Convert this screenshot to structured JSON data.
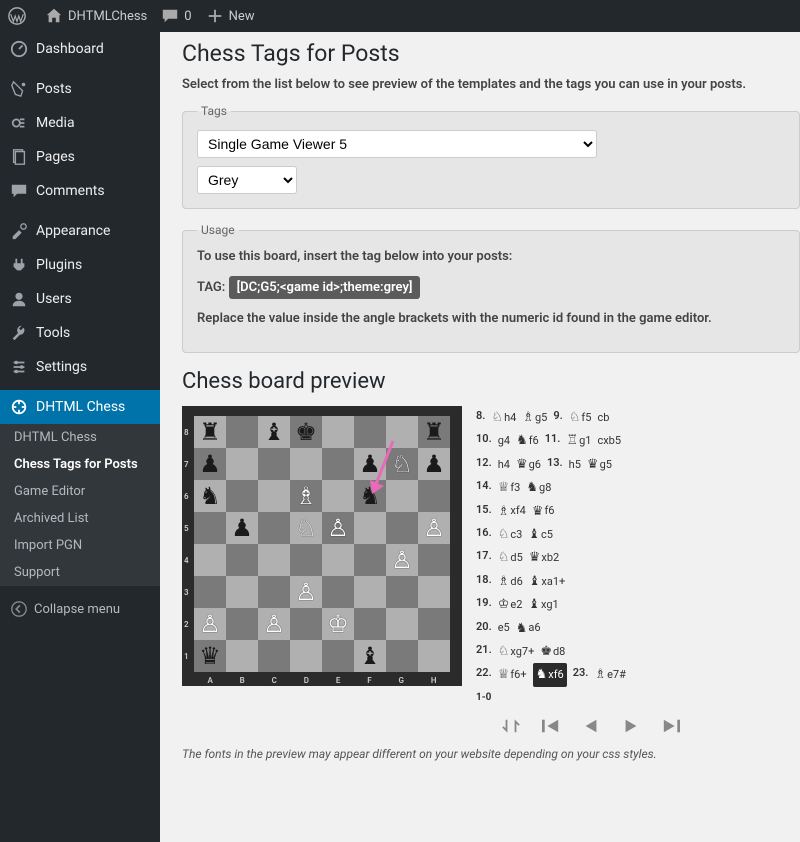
{
  "topbar": {
    "site": "DHTMLChess",
    "comments": "0",
    "new": "New"
  },
  "sidebar": {
    "dashboard": "Dashboard",
    "posts": "Posts",
    "media": "Media",
    "pages": "Pages",
    "comments": "Comments",
    "appearance": "Appearance",
    "plugins": "Plugins",
    "users": "Users",
    "tools": "Tools",
    "settings": "Settings",
    "dhtml_chess": "DHTML Chess",
    "sub": {
      "dhtml_chess": "DHTML Chess",
      "chess_tags": "Chess Tags for Posts",
      "game_editor": "Game Editor",
      "archived_list": "Archived List",
      "import_pgn": "Import PGN",
      "support": "Support"
    },
    "collapse": "Collapse menu"
  },
  "page": {
    "title": "Chess Tags for Posts",
    "intro": "Select from the list below to see preview of the templates and the tags you can use in your posts.",
    "tags_legend": "Tags",
    "template_selected": "Single Game Viewer 5",
    "theme_selected": "Grey",
    "usage_legend": "Usage",
    "usage_line1": "To use this board, insert the tag below into your posts:",
    "tag_label": "TAG:",
    "tag_value": "[DC;G5;<game id>;theme:grey]",
    "usage_line2": "Replace the value inside the angle brackets with the numeric id found in the game editor.",
    "preview_title": "Chess board preview",
    "footnote": "The fonts in the preview may appear different on your website depending on your css styles."
  },
  "board": {
    "ranks": [
      "8",
      "7",
      "6",
      "5",
      "4",
      "3",
      "2",
      "1"
    ],
    "files": [
      "A",
      "B",
      "C",
      "D",
      "E",
      "F",
      "G",
      "H"
    ],
    "pieces": [
      [
        "r",
        "",
        "b",
        "k",
        "",
        "",
        "",
        "r"
      ],
      [
        "p",
        "",
        "",
        "",
        "",
        "p",
        "N",
        "p"
      ],
      [
        "n",
        "",
        "",
        "B",
        "",
        "n",
        "",
        ""
      ],
      [
        "",
        "p",
        "",
        "N",
        "P",
        "",
        "",
        "P"
      ],
      [
        "",
        "",
        "",
        "",
        "",
        "",
        "P",
        ""
      ],
      [
        "",
        "",
        "",
        "P",
        "",
        "",
        "",
        ""
      ],
      [
        "P",
        "",
        "P",
        "",
        "K",
        "",
        "",
        ""
      ],
      [
        "q",
        "",
        "",
        "",
        "",
        "b",
        "",
        ""
      ]
    ]
  },
  "moves": {
    "rows": [
      [
        {
          "n": "8."
        },
        {
          "p": "♘",
          "t": "h4",
          "c": "b"
        },
        {
          "p": "♗",
          "t": "g5",
          "c": "b"
        },
        {
          "n": "9."
        },
        {
          "p": "♘",
          "t": "f5",
          "c": "b"
        },
        {
          "t": "cb"
        }
      ],
      [
        {
          "n": "10."
        },
        {
          "t": "g4"
        },
        {
          "p": "♞",
          "t": "f6",
          "c": "b"
        },
        {
          "n": "11."
        },
        {
          "p": "♖",
          "t": "g1",
          "c": "b"
        },
        {
          "t": "cxb5"
        }
      ],
      [
        {
          "n": "12."
        },
        {
          "t": "h4"
        },
        {
          "p": "♛",
          "t": "g6",
          "c": "b"
        },
        {
          "n": "13."
        },
        {
          "t": "h5"
        },
        {
          "p": "♛",
          "t": "g5",
          "c": "b"
        }
      ],
      [
        {
          "n": "14."
        },
        {
          "p": "♕",
          "t": "f3",
          "c": "b"
        },
        {
          "p": "♞",
          "t": "g8",
          "c": "b"
        }
      ],
      [
        {
          "n": "15."
        },
        {
          "p": "♗",
          "t": "xf4",
          "c": "b"
        },
        {
          "p": "♛",
          "t": "f6",
          "c": "b"
        }
      ],
      [
        {
          "n": "16."
        },
        {
          "p": "♘",
          "t": "c3",
          "c": "b"
        },
        {
          "p": "♝",
          "t": "c5",
          "c": "b"
        }
      ],
      [
        {
          "n": "17."
        },
        {
          "p": "♘",
          "t": "d5",
          "c": "b"
        },
        {
          "p": "♛",
          "t": "xb2",
          "c": "b"
        }
      ],
      [
        {
          "n": "18."
        },
        {
          "p": "♗",
          "t": "d6",
          "c": "b"
        },
        {
          "p": "♝",
          "t": "xa1+",
          "c": "b"
        }
      ],
      [
        {
          "n": "19."
        },
        {
          "p": "♔",
          "t": "e2",
          "c": "b"
        },
        {
          "p": "♝",
          "t": "xg1",
          "c": "b"
        }
      ],
      [
        {
          "n": "20."
        },
        {
          "t": "e5"
        },
        {
          "p": "♞",
          "t": "a6",
          "c": "b"
        }
      ],
      [
        {
          "n": "21."
        },
        {
          "p": "♘",
          "t": "xg7+",
          "c": "b"
        },
        {
          "p": "♚",
          "t": "d8",
          "c": "b"
        }
      ],
      [
        {
          "n": "22."
        },
        {
          "p": "♕",
          "t": "f6+",
          "c": "b"
        },
        {
          "p": "♞",
          "t": "xf6",
          "c": "b",
          "hl": true
        },
        {
          "n": "23."
        },
        {
          "p": "♗",
          "t": "e7#",
          "c": "b"
        }
      ]
    ],
    "result": "1-0"
  }
}
